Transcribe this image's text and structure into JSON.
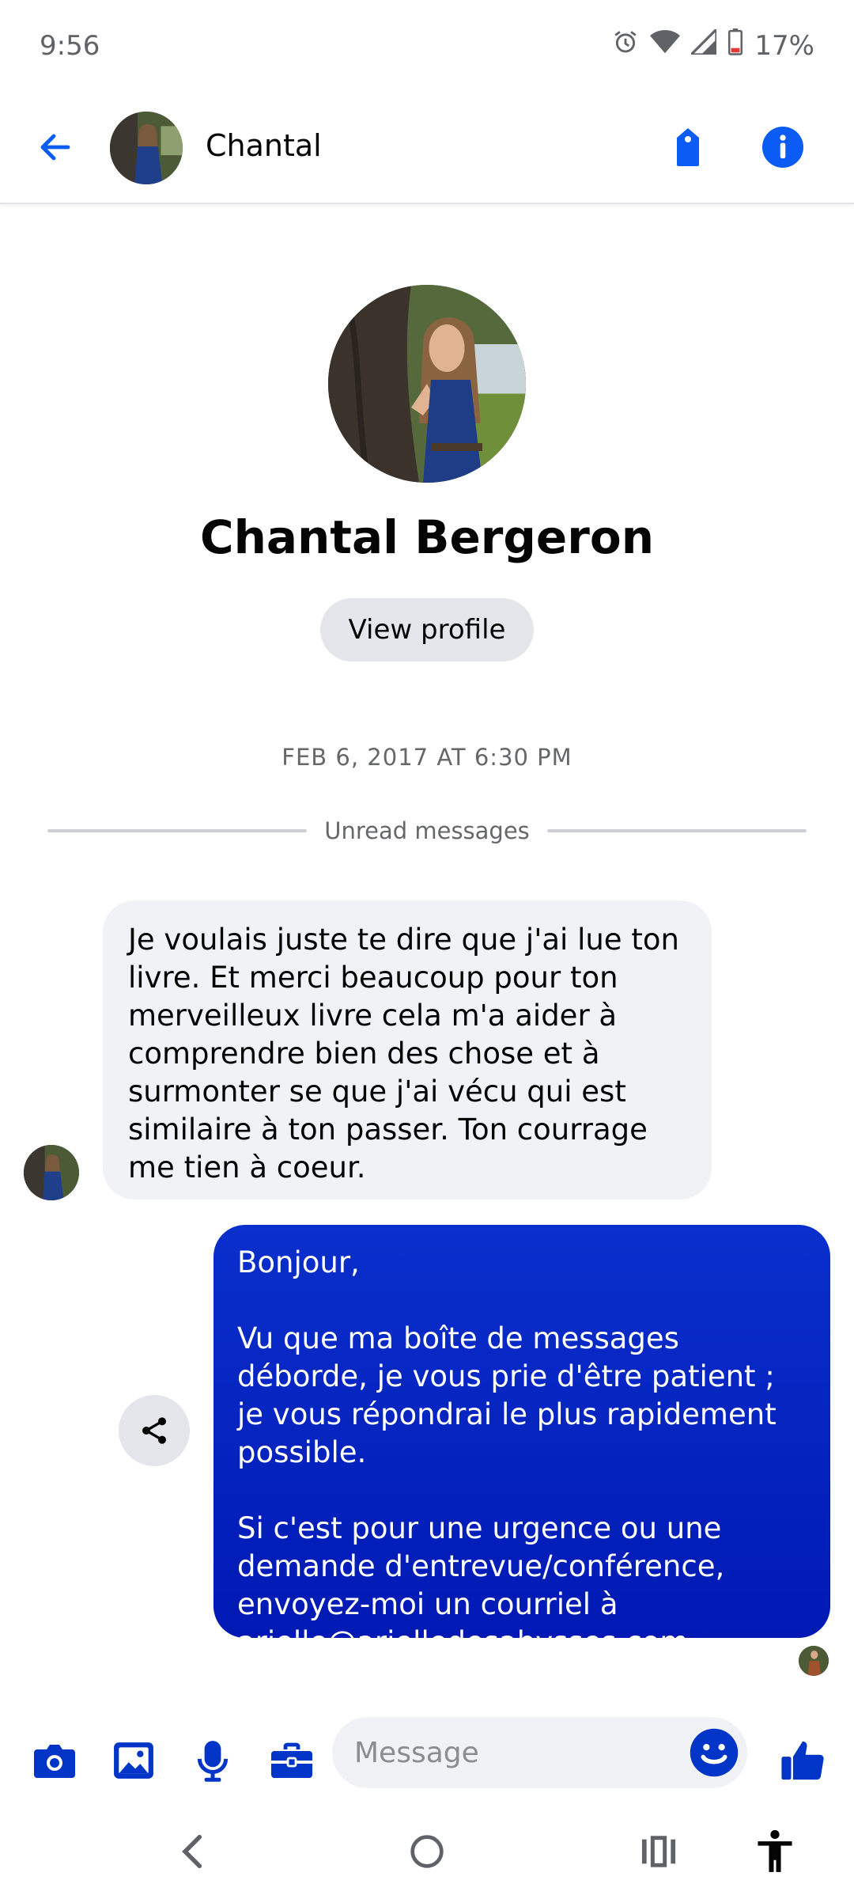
{
  "status_bar": {
    "time": "9:56",
    "battery": "17%",
    "icons": [
      "alarm-icon",
      "wifi-icon",
      "signal-icon",
      "battery-icon"
    ]
  },
  "header": {
    "contact_name": "Chantal",
    "icons": [
      "back-arrow-icon",
      "tag-icon",
      "info-icon"
    ]
  },
  "profile": {
    "full_name": "Chantal Bergeron",
    "view_profile_label": "View profile"
  },
  "conversation": {
    "timestamp": "FEB 6, 2017 AT 6:30 PM",
    "unread_label": "Unread messages",
    "incoming_message": "Je voulais juste te dire que j'ai lue ton livre. Et merci beaucoup pour ton merveilleux livre cela m'a aider à comprendre bien  des chose et à surmonter se que j'ai vécu qui est similaire à ton passer. Ton courrage me tien à coeur.",
    "outgoing_message": {
      "greeting": "Bonjour,",
      "paragraph_1": "Vu que ma boîte de messages déborde, je vous prie d'être patient ; je vous répondrai le plus rapidement possible.",
      "paragraph_2": "Si c'est pour une urgence ou une demande d'entrevue/conférence, envoyez-moi un courriel à",
      "email": "arielle@arielledesabysses.com",
      "trailing": "."
    }
  },
  "composer": {
    "placeholder": "Message",
    "icons": [
      "camera-icon",
      "gallery-icon",
      "microphone-icon",
      "briefcase-icon",
      "emoji-icon",
      "thumbs-up-icon"
    ]
  },
  "navigation": {
    "icons": [
      "nav-back-icon",
      "nav-home-icon",
      "nav-recents-icon",
      "accessibility-icon"
    ]
  },
  "colors": {
    "accent": "#0a5cf5",
    "bubble_outgoing": "#0019b4",
    "bubble_incoming": "#f0f2f5",
    "icon_blue": "#0035c8"
  }
}
